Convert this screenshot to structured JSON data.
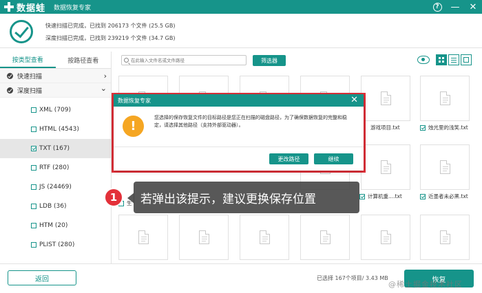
{
  "titlebar": {
    "logo_text": "数据蛙",
    "app_subtitle": "数据恢复专家",
    "help_icon": "help-circle-icon",
    "minimize_icon": "minimize-icon",
    "close_icon": "close-icon"
  },
  "scan_status": {
    "icon": "check-circle-icon",
    "quick_scan": "快速扫描已完成，已找到 206173 个文件 (25.5 GB)",
    "deep_scan": "深度扫描已完成，已找到 239219 个文件 (34.7 GB)"
  },
  "sidebar": {
    "tabs": [
      "按类型查看",
      "按路径查看"
    ],
    "active_tab": "按类型查看",
    "tree": [
      {
        "label": "快速扫描",
        "arrow": "›"
      },
      {
        "label": "深度扫描",
        "arrow": "⌄"
      }
    ],
    "types": [
      {
        "label": "XML (709)",
        "checked": false
      },
      {
        "label": "HTML (4543)",
        "checked": false
      },
      {
        "label": "TXT (167)",
        "checked": true,
        "selected": true
      },
      {
        "label": "RTF (280)",
        "checked": false
      },
      {
        "label": "JS (24469)",
        "checked": false
      },
      {
        "label": "LDB (36)",
        "checked": false
      },
      {
        "label": "HTM (20)",
        "checked": false
      },
      {
        "label": "PLIST (280)",
        "checked": false
      }
    ]
  },
  "toolbar": {
    "search_placeholder": "在此输入文件名或文件路径",
    "filter_label": "筛选器",
    "view_icons": [
      "eye-icon",
      "grid-view-icon",
      "list-view-icon",
      "detail-view-icon"
    ]
  },
  "files": [
    {
      "name": "",
      "checked": false
    },
    {
      "name": "",
      "checked": false
    },
    {
      "name": "",
      "checked": false
    },
    {
      "name": "",
      "checked": false
    },
    {
      "name": "游戏项目.txt",
      "checked": false
    },
    {
      "name": "烛光里的浅笑.txt",
      "checked": true
    },
    {
      "name": "",
      "checked": false
    },
    {
      "name": "",
      "checked": false
    },
    {
      "name": "",
      "checked": false
    },
    {
      "name": "",
      "checked": false
    },
    {
      "name": "计算机重....txt",
      "checked": true
    },
    {
      "name": "近墨者未必黑.txt",
      "checked": true
    },
    {
      "name": "生",
      "checked": false
    }
  ],
  "dialog": {
    "title": "数据恢复专家",
    "message": "您选择的保存恢复文件的目标路径是您正在扫描的磁盘路径，为了确保数据恢复的完整和稳定，请选择其他路径（支持外部驱动器）。",
    "change_path_label": "更改路径",
    "continue_label": "继续",
    "warn_glyph": "!"
  },
  "callout": {
    "step": "1",
    "text": "若弹出该提示，建议更换保存位置"
  },
  "bottom": {
    "back_label": "返回",
    "selected_info": "已选择 167个项目/ 3.43 MB",
    "recover_label": "恢复",
    "watermark": "@稀土掘金技术社区"
  },
  "colors": {
    "accent": "#16948a",
    "highlight_border": "#e3313a",
    "warning": "#f5a623"
  }
}
